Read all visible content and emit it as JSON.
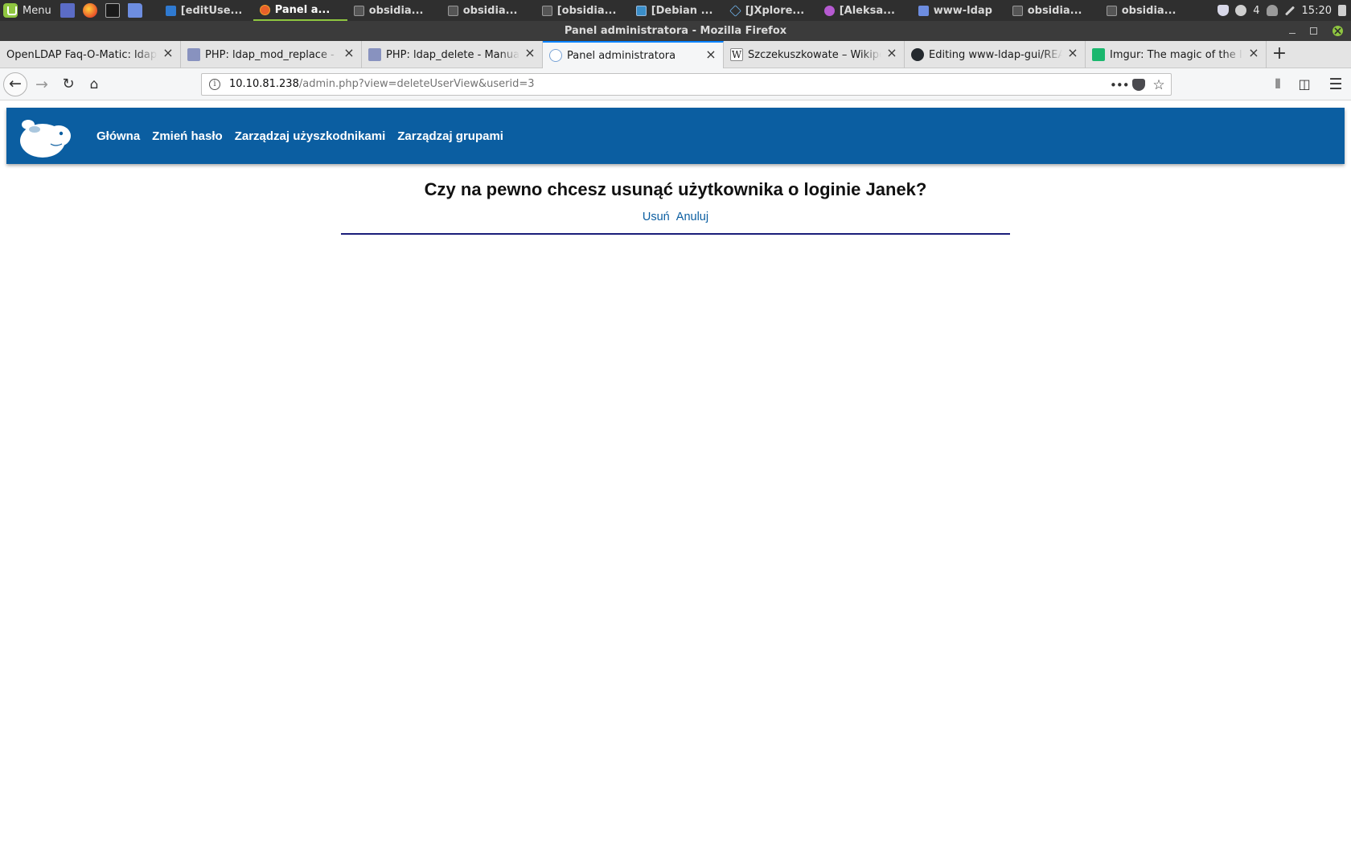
{
  "os": {
    "menu_label": "Menu",
    "apps": [
      {
        "label": "[editUse...",
        "icon": "vscode-icon"
      },
      {
        "label": "Panel a...",
        "icon": "firefox-icon",
        "active": true
      },
      {
        "label": "obsidia...",
        "icon": "terminal-icon"
      },
      {
        "label": "obsidia...",
        "icon": "terminal-icon"
      },
      {
        "label": "[obsidia...",
        "icon": "terminal-icon"
      },
      {
        "label": "[Debian ...",
        "icon": "libreoffice-icon"
      },
      {
        "label": "[JXplore...",
        "icon": "jxplorer-icon"
      },
      {
        "label": "[Aleksa...",
        "icon": "pidgin-icon"
      },
      {
        "label": "www-ldap",
        "icon": "folder-icon"
      },
      {
        "label": "obsidia...",
        "icon": "terminal-icon"
      },
      {
        "label": "obsidia...",
        "icon": "terminal-icon"
      }
    ],
    "tray": {
      "notification_count": "4",
      "clock": "15:20"
    }
  },
  "window": {
    "title": "Panel administratora - Mozilla Firefox"
  },
  "browser": {
    "tabs": [
      {
        "title": "OpenLDAP Faq-O-Matic: ldap_add",
        "icon": "openldap-icon"
      },
      {
        "title": "PHP: ldap_mod_replace - Manual",
        "icon": "php-icon"
      },
      {
        "title": "PHP: ldap_delete - Manual",
        "icon": "php-icon"
      },
      {
        "title": "Panel administratora",
        "icon": "cavy-icon",
        "active": true
      },
      {
        "title": "Szczekuszkowate – Wikipedia",
        "icon": "wikipedia-icon"
      },
      {
        "title": "Editing www-ldap-gui/README.md",
        "icon": "github-icon"
      },
      {
        "title": "Imgur: The magic of the Internet",
        "icon": "imgur-icon"
      }
    ],
    "url_host": "10.10.81.238",
    "url_path": "/admin.php?view=deleteUserView&userid=3"
  },
  "site": {
    "nav": [
      "Główna",
      "Zmień hasło",
      "Zarządzaj użyszkodnikami",
      "Zarządzaj grupami"
    ],
    "brand_color": "#0b5ea1",
    "confirm_question": "Czy na pewno chcesz usunąć użytkownika o loginie Janek?",
    "delete_label": "Usuń",
    "cancel_label": "Anuluj"
  }
}
